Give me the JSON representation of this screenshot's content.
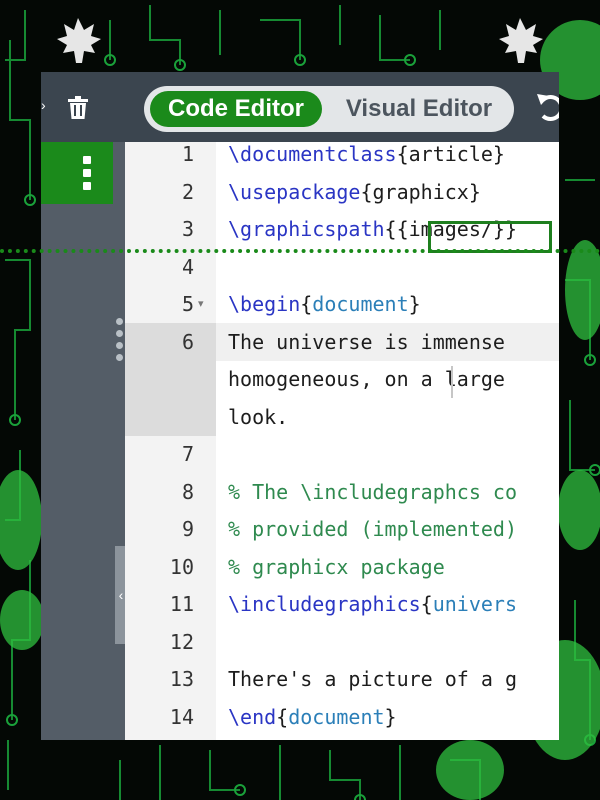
{
  "toolbar": {
    "code_editor_label": "Code Editor",
    "visual_editor_label": "Visual Editor",
    "active_mode": "Code Editor",
    "icons": [
      "trash-icon",
      "undo-icon"
    ]
  },
  "sidebar": {
    "menu_icon": "vertical-dots-icon",
    "collapse_icon": "chevron-left-icon"
  },
  "editor": {
    "lines": [
      {
        "num": "1",
        "segments": [
          {
            "t": "\\documentclass",
            "c": "cmd"
          },
          {
            "t": "{article}",
            "c": "arg"
          }
        ]
      },
      {
        "num": "2",
        "segments": [
          {
            "t": "\\usepackage",
            "c": "cmd"
          },
          {
            "t": "{graphicx}",
            "c": "arg"
          }
        ]
      },
      {
        "num": "3",
        "segments": [
          {
            "t": "\\graphicspath",
            "c": "cmd"
          },
          {
            "t": "{{images/}}",
            "c": "arg"
          }
        ]
      },
      {
        "num": "4",
        "segments": []
      },
      {
        "num": "5",
        "segments": [
          {
            "t": "\\begin",
            "c": "cmd"
          },
          {
            "t": "{",
            "c": "arg"
          },
          {
            "t": "document",
            "c": "env"
          },
          {
            "t": "}",
            "c": "arg"
          }
        ],
        "fold": true
      },
      {
        "num": "6",
        "segments": [
          {
            "t": "The universe is immense",
            "c": "arg"
          }
        ]
      },
      {
        "num": "",
        "segments": [
          {
            "t": "homogeneous, on a large",
            "c": "arg"
          }
        ]
      },
      {
        "num": "",
        "segments": [
          {
            "t": "look.",
            "c": "arg"
          }
        ]
      },
      {
        "num": "7",
        "segments": []
      },
      {
        "num": "8",
        "segments": [
          {
            "t": "% The \\includegraphcs co",
            "c": "comment"
          }
        ]
      },
      {
        "num": "9",
        "segments": [
          {
            "t": "% provided (implemented)",
            "c": "comment"
          }
        ]
      },
      {
        "num": "10",
        "segments": [
          {
            "t": "% graphicx package",
            "c": "comment"
          }
        ]
      },
      {
        "num": "11",
        "segments": [
          {
            "t": "\\includegraphics",
            "c": "cmd"
          },
          {
            "t": "{",
            "c": "arg"
          },
          {
            "t": "univers",
            "c": "env"
          }
        ]
      },
      {
        "num": "12",
        "segments": []
      },
      {
        "num": "13",
        "segments": [
          {
            "t": "There's a picture of a g",
            "c": "arg"
          }
        ]
      },
      {
        "num": "14",
        "segments": [
          {
            "t": "\\end",
            "c": "cmd"
          },
          {
            "t": "{",
            "c": "arg"
          },
          {
            "t": "document",
            "c": "env"
          },
          {
            "t": "}",
            "c": "arg"
          }
        ]
      }
    ]
  },
  "colors": {
    "accent": "#1b8a1b",
    "toolbar_bg": "#3b454f",
    "command": "#2a35c4",
    "environment": "#2b7fb8",
    "comment": "#2f8a4f"
  }
}
